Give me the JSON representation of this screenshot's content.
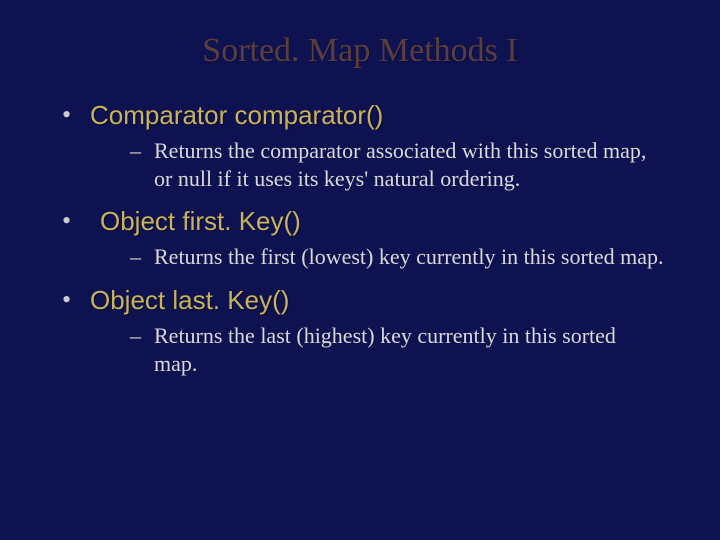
{
  "title": {
    "part1": "Sorted. Map",
    "part2": " Methods I"
  },
  "bullets": [
    {
      "heading": "Comparator comparator()",
      "indent": false,
      "sub": "Returns the comparator associated with this sorted map, or null if it uses its keys' natural ordering."
    },
    {
      "heading": "Object first. Key()",
      "indent": true,
      "sub": "Returns the first (lowest) key currently in this sorted map."
    },
    {
      "heading": "Object last. Key()",
      "indent": false,
      "sub": "Returns the last (highest) key currently in this sorted map."
    }
  ]
}
